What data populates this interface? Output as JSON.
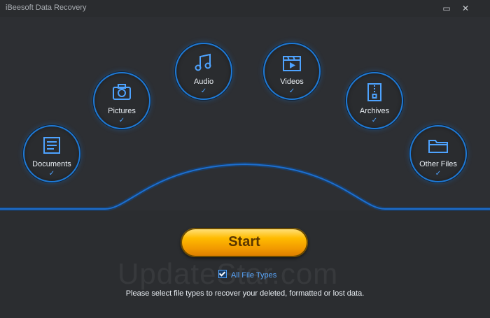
{
  "window": {
    "title": "iBeesoft Data Recovery"
  },
  "categories": [
    {
      "label": "Documents",
      "icon": "document-icon",
      "checked": true
    },
    {
      "label": "Pictures",
      "icon": "camera-icon",
      "checked": true
    },
    {
      "label": "Audio",
      "icon": "music-note-icon",
      "checked": true
    },
    {
      "label": "Videos",
      "icon": "video-icon",
      "checked": true
    },
    {
      "label": "Archives",
      "icon": "archive-icon",
      "checked": true
    },
    {
      "label": "Other Files",
      "icon": "folder-icon",
      "checked": true
    }
  ],
  "start": {
    "label": "Start"
  },
  "all_file_types": {
    "label": "All File Types",
    "checked": true
  },
  "hint": {
    "text": "Please select file types to recover your deleted, formatted or lost data."
  },
  "watermark": {
    "text": "UpdateStar.com"
  },
  "colors": {
    "accent": "#1f7ad6",
    "start_button": "#ffbb00",
    "background": "#2b2d30"
  },
  "icons": {
    "checkmark": "✓",
    "minimize": "minimize-icon",
    "close": "close-icon"
  }
}
